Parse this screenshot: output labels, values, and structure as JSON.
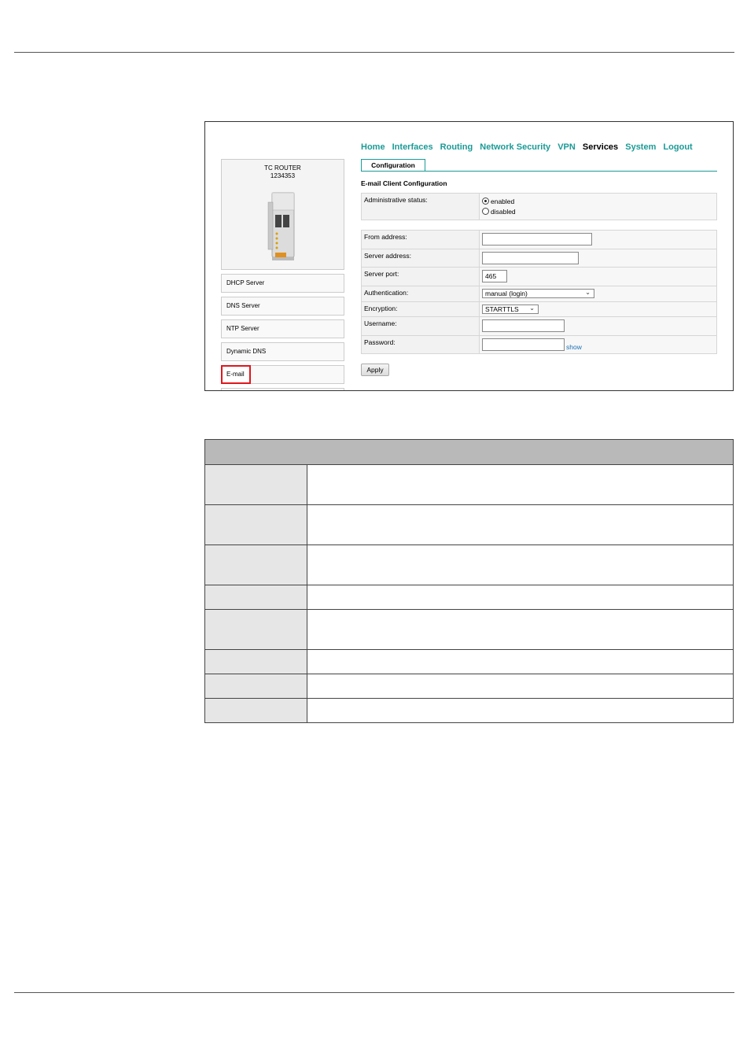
{
  "colors": {
    "nav_link": "#1a9a96",
    "nav_active": "#000000",
    "highlight_border": "#e0161d",
    "link_blue": "#1a70b8"
  },
  "nav": {
    "items": [
      {
        "label": "Home",
        "active": false
      },
      {
        "label": "Interfaces",
        "active": false
      },
      {
        "label": "Routing",
        "active": false
      },
      {
        "label": "Network Security",
        "active": false
      },
      {
        "label": "VPN",
        "active": false
      },
      {
        "label": "Services",
        "active": true
      },
      {
        "label": "System",
        "active": false
      },
      {
        "label": "Logout",
        "active": false
      }
    ]
  },
  "tab": {
    "label": "Configuration"
  },
  "section_title": "E-mail Client Configuration",
  "device": {
    "name_line1": "TC ROUTER",
    "name_line2": "1234353"
  },
  "sidebar": {
    "items": [
      {
        "label": "DHCP Server"
      },
      {
        "label": "DNS Server"
      },
      {
        "label": "NTP Server"
      },
      {
        "label": "Dynamic DNS"
      },
      {
        "label": "E-mail",
        "selected": true
      }
    ]
  },
  "admin": {
    "label": "Administrative status:",
    "option_enabled": "enabled",
    "option_disabled": "disabled",
    "selected": "enabled"
  },
  "form": {
    "from_address": {
      "label": "From address:",
      "value": ""
    },
    "server_address": {
      "label": "Server address:",
      "value": ""
    },
    "server_port": {
      "label": "Server port:",
      "value": "465"
    },
    "authentication": {
      "label": "Authentication:",
      "value": "manual (login)"
    },
    "encryption": {
      "label": "Encryption:",
      "value": "STARTTLS"
    },
    "username": {
      "label": "Username:",
      "value": ""
    },
    "password": {
      "label": "Password:",
      "value": "",
      "show_label": "show"
    }
  },
  "apply_label": "Apply",
  "description_table": {
    "rows": 8
  }
}
